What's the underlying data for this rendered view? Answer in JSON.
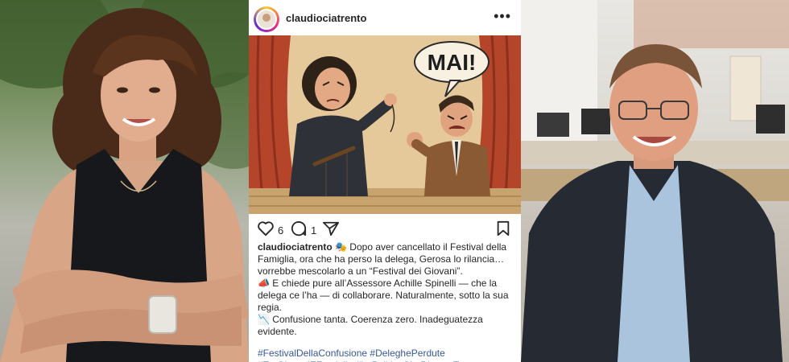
{
  "post": {
    "username": "claudiociatrento",
    "image": {
      "speech_bubble": "MAI!"
    },
    "likes": "6",
    "comments": "1",
    "caption": {
      "line1": "🎭 Dopo aver cancellato il Festival della Famiglia, ora che ha perso la delega, Gerosa lo rilancia… vorrebbe mescolarlo a un “Festival dei Giovani”.",
      "line2": "📣 E chiede pure all’Assessore Achille Spinelli — che la delega ce l’ha — di collaborare. Naturalmente, sotto la sua regia.",
      "line3": "📉 Confusione tanta. Coerenza zero. Inadeguatezza evidente.",
      "hashtags": "#FestivalDellaConfusione #DeleghePerdute #TraGiovaniEFamiglie #LaPoliticaCheDiventaTeatro"
    }
  },
  "icons": {
    "like": "heart-icon",
    "comment": "comment-icon",
    "share": "send-icon",
    "save": "bookmark-icon",
    "more": "more-options-icon"
  },
  "colors": {
    "hashtag": "#385898",
    "text": "#262626",
    "stage": "#c9a36e",
    "curtain": "#b4452a"
  }
}
